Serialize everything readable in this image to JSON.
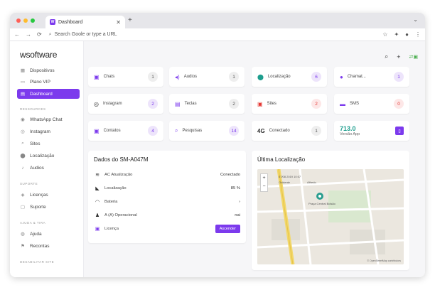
{
  "browser": {
    "tab_title": "Dashboard",
    "tab_logo": "W",
    "url": "Search Goole or type a URL",
    "colors": {
      "close": "#ff5f57",
      "min": "#febc2e",
      "max": "#28c840"
    }
  },
  "sidebar": {
    "brand": "wsoftware",
    "items_top": [
      {
        "icon": "grid-icon",
        "label": "Dispositivos"
      },
      {
        "icon": "card-icon",
        "label": "Plano VIP"
      },
      {
        "icon": "dashboard-icon",
        "label": "Dashboard"
      }
    ],
    "section_resources": "RESSOURCES",
    "items_resources": [
      {
        "icon": "whatsapp-icon",
        "label": "WhatsApp Chat"
      },
      {
        "icon": "instagram-icon",
        "label": "Instagram"
      },
      {
        "icon": "search-icon",
        "label": "Sites"
      },
      {
        "icon": "location-icon",
        "label": "Localização"
      },
      {
        "icon": "audio-icon",
        "label": "Audios"
      }
    ],
    "section_support": "SUPORTE",
    "items_support": [
      {
        "icon": "license-icon",
        "label": "Licenças"
      },
      {
        "icon": "support-icon",
        "label": "Suporte"
      }
    ],
    "section_help": "AJUDA & TIRA",
    "items_help": [
      {
        "icon": "help-icon",
        "label": "Ajuda"
      },
      {
        "icon": "flag-icon",
        "label": "Recontas"
      }
    ],
    "section_extra": "DESABILITAR SITE"
  },
  "cards": [
    {
      "label": "Chats",
      "value": "1",
      "icon_color": "#7c3aed",
      "badge_bg": "#eeeeee",
      "badge_fg": "#555555"
    },
    {
      "label": "Audios",
      "value": "1",
      "icon_color": "#7c3aed",
      "badge_bg": "#eeeeee",
      "badge_fg": "#555555"
    },
    {
      "label": "Localização",
      "value": "6",
      "icon_color": "#1e9e8e",
      "badge_bg": "#ede4fb",
      "badge_fg": "#7c3aed"
    },
    {
      "label": "Chamat...",
      "value": "1",
      "icon_color": "#7c3aed",
      "badge_bg": "#ede4fb",
      "badge_fg": "#7c3aed"
    },
    {
      "label": "Instagram",
      "value": "2",
      "icon_color": "#333333",
      "badge_bg": "#ede4fb",
      "badge_fg": "#7c3aed"
    },
    {
      "label": "Teclas",
      "value": "2",
      "icon_color": "#7c3aed",
      "badge_bg": "#eeeeee",
      "badge_fg": "#555555"
    },
    {
      "label": "Sites",
      "value": "2",
      "icon_color": "#e53935",
      "badge_bg": "#fde7e7",
      "badge_fg": "#e53935"
    },
    {
      "label": "SMS",
      "value": "0",
      "icon_color": "#7c3aed",
      "badge_bg": "#fde7e7",
      "badge_fg": "#e53935"
    },
    {
      "label": "Contatos",
      "value": "4",
      "icon_color": "#7c3aed",
      "badge_bg": "#ede4fb",
      "badge_fg": "#7c3aed"
    },
    {
      "label": "Pesquisas",
      "value": "14",
      "icon_color": "#7c3aed",
      "badge_bg": "#ede4fb",
      "badge_fg": "#7c3aed"
    },
    {
      "label": "Conectado",
      "big": "4G",
      "value": "1",
      "badge_bg": "#eeeeee",
      "badge_fg": "#555555"
    },
    {
      "version": "713.0",
      "label": "Versão App"
    }
  ],
  "device": {
    "title": "Dados do SM-A047M",
    "rows": [
      {
        "icon": "wifi-icon",
        "label": "AC Atualização",
        "value": "Conectado"
      },
      {
        "icon": "signal-icon",
        "label": "Localização",
        "value": "85 %"
      },
      {
        "icon": "gauge-icon",
        "label": "Bateria",
        "value": "›"
      },
      {
        "icon": "person-icon",
        "label": "A (A) Operacional",
        "value": "nai"
      },
      {
        "icon": "license-icon",
        "label": "Licença",
        "button": "Ascender"
      }
    ]
  },
  "location": {
    "title": "Última Localização",
    "map_labels": [
      "07/08 2019 10:07",
      "Ocidente",
      "Alfredo",
      "Praça Central Bolsão"
    ],
    "attribution": "© OpenStreetMap contributors"
  }
}
